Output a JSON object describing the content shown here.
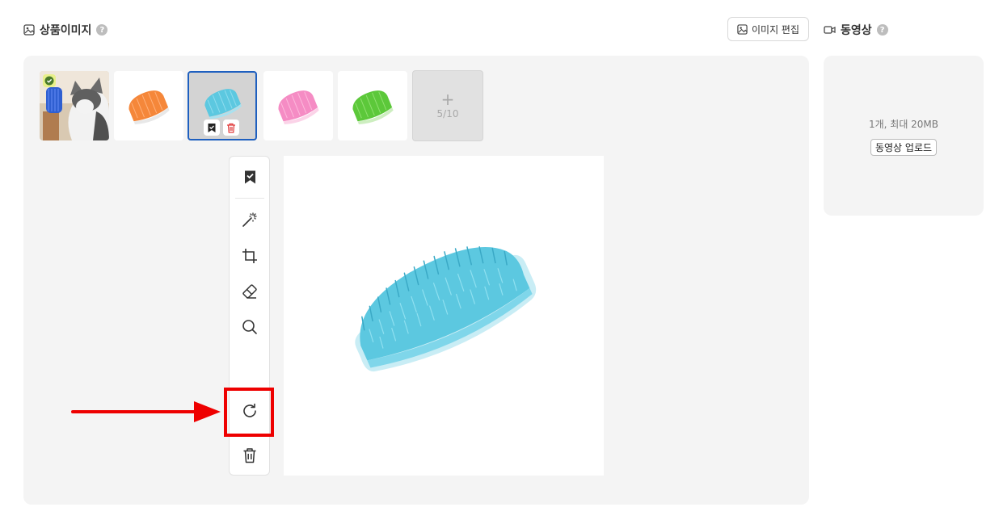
{
  "header": {
    "product_images_title": "상품이미지",
    "help_mark": "?",
    "edit_image_button": "이미지 편집",
    "video_title": "동영상"
  },
  "thumbnails": [
    {
      "name": "cat-with-blue-brush",
      "is_representative": true
    },
    {
      "name": "orange-brush"
    },
    {
      "name": "blue-brush",
      "selected": true
    },
    {
      "name": "pink-brush"
    },
    {
      "name": "green-brush"
    }
  ],
  "add_tile": {
    "plus": "+",
    "count": "5/10"
  },
  "toolbar": {
    "tools": [
      "bookmark-check-icon",
      "magic-wand-icon",
      "crop-icon",
      "eraser-icon",
      "search-icon",
      "rotate-icon",
      "trash-icon"
    ],
    "highlighted_tool": "rotate-icon"
  },
  "video": {
    "info": "1개, 최대 20MB",
    "upload_button": "동영상 업로드"
  },
  "colors": {
    "selected_border": "#1e5fbf",
    "annotation_red": "#ee0000",
    "panel_bg": "#f4f4f4",
    "brush_blue": "#5cc8e0",
    "brush_orange": "#f5873a",
    "brush_pink": "#f58cc4",
    "brush_green": "#5cc83a"
  }
}
